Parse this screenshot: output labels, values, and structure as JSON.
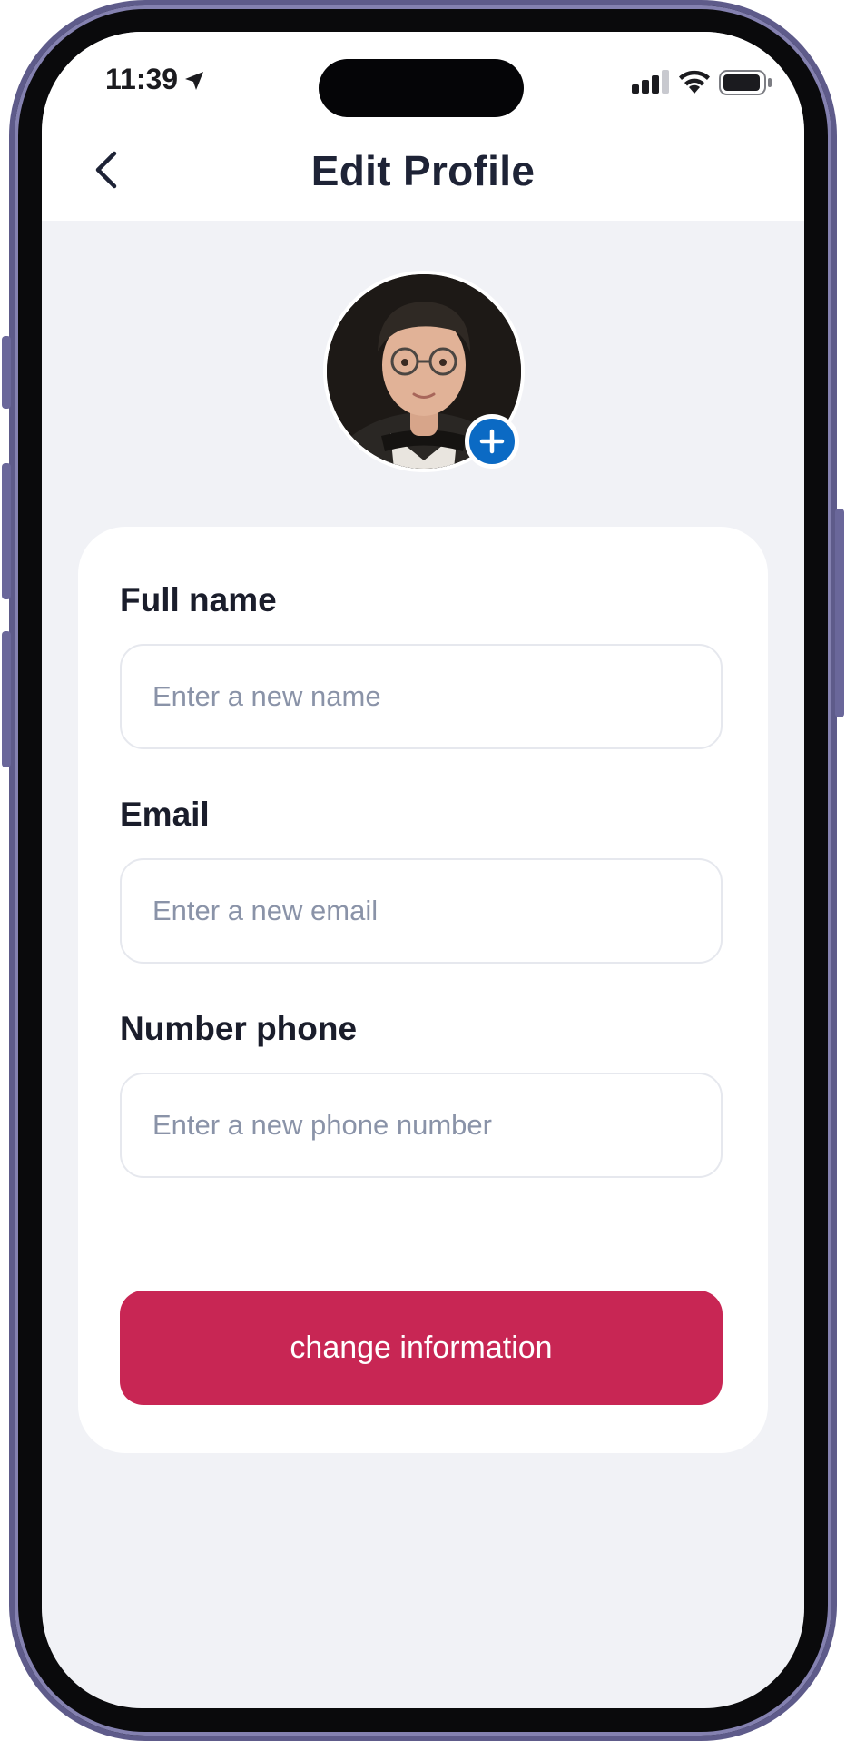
{
  "status_bar": {
    "time": "11:39",
    "location_icon": "location-arrow-icon",
    "signal_icon": "cellular-signal-icon",
    "wifi_icon": "wifi-icon",
    "battery_icon": "battery-icon"
  },
  "header": {
    "title": "Edit Profile",
    "back_icon": "chevron-left-icon"
  },
  "profile": {
    "avatar_icon": "avatar-image",
    "add_photo_icon": "plus-icon"
  },
  "form": {
    "fields": [
      {
        "label": "Full name",
        "value": "",
        "placeholder": "Enter a new name"
      },
      {
        "label": "Email",
        "value": "",
        "placeholder": "Enter a new email"
      },
      {
        "label": "Number phone",
        "value": "",
        "placeholder": "Enter a new phone number"
      }
    ],
    "submit_label": "change information"
  },
  "colors": {
    "accent": "#c82654",
    "add_photo": "#0b6ac4",
    "background": "#f1f2f6",
    "card": "#ffffff"
  }
}
